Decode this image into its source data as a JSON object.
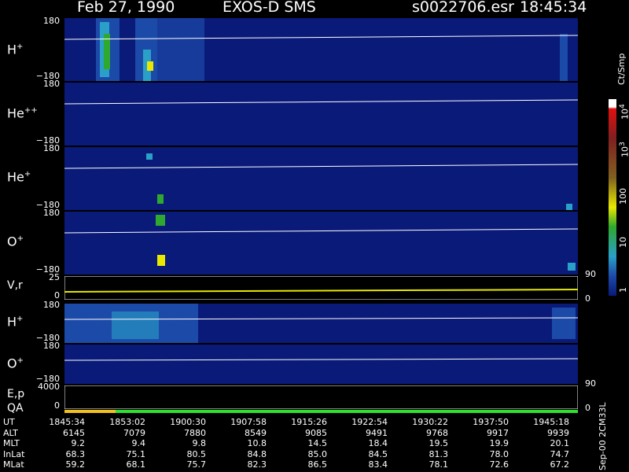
{
  "header": {
    "date": "Feb 27, 1990",
    "instrument": "EXOS-D SMS",
    "file": "s0022706.esr",
    "time": "18:45:34"
  },
  "panels": [
    {
      "label_main": "H",
      "label_sup": "+",
      "ymax": "180",
      "ymin": "−180"
    },
    {
      "label_main": "He",
      "label_sup": "++",
      "ymax": "180",
      "ymin": "−180"
    },
    {
      "label_main": "He",
      "label_sup": "+",
      "ymax": "180",
      "ymin": "−180"
    },
    {
      "label_main": "O",
      "label_sup": "+",
      "ymax": "180",
      "ymin": "−180"
    },
    {
      "label_main": "V,r",
      "label_sup": "",
      "ymax": "25",
      "ymin": "0",
      "rmax": "90",
      "rmin": "0"
    },
    {
      "label_main": "H",
      "label_sup": "+",
      "ymax": "180",
      "ymin": "−180"
    },
    {
      "label_main": "O",
      "label_sup": "+",
      "ymax": "180",
      "ymin": "−180"
    },
    {
      "label_main": "E,p",
      "label_sup": "",
      "ymax": "4000",
      "ymin": "0",
      "rmax": "90",
      "rmin": "0"
    }
  ],
  "qa_label": "QA",
  "colorbar": {
    "unit": "Ct/Smp",
    "tick_1e4_base": "10",
    "tick_1e4_exp": "4",
    "tick_1e3_base": "10",
    "tick_1e3_exp": "3",
    "tick_100": "100",
    "tick_10": "10",
    "tick_1": "1"
  },
  "footer_right": "Sep-00 2CM33L",
  "orbit_table": {
    "rows": [
      {
        "label": "UT",
        "values": [
          "1845:34",
          "1853:02",
          "1900:30",
          "1907:58",
          "1915:26",
          "1922:54",
          "1930:22",
          "1937:50",
          "1945:18"
        ]
      },
      {
        "label": "ALT",
        "values": [
          "6145",
          "7079",
          "7880",
          "8549",
          "9085",
          "9491",
          "9768",
          "9917",
          "9939"
        ]
      },
      {
        "label": "MLT",
        "values": [
          "9.2",
          "9.4",
          "9.8",
          "10.8",
          "14.5",
          "18.4",
          "19.5",
          "19.9",
          "20.1"
        ]
      },
      {
        "label": "InLat",
        "values": [
          "68.3",
          "75.1",
          "80.5",
          "84.8",
          "85.0",
          "84.5",
          "81.3",
          "78.0",
          "74.7"
        ]
      },
      {
        "label": "MLat",
        "values": [
          "59.2",
          "68.1",
          "75.7",
          "82.3",
          "86.5",
          "83.4",
          "78.1",
          "72.6",
          "67.2"
        ]
      }
    ]
  },
  "chart_data": {
    "type": "heatmap",
    "title": "Feb 27, 1990   EXOS-D SMS",
    "x_tick_labels": [
      "1845:34",
      "1853:02",
      "1900:30",
      "1907:58",
      "1915:26",
      "1922:54",
      "1930:22",
      "1937:50",
      "1945:18"
    ],
    "xlabel": "UT",
    "colorbar_unit": "Ct/Smp",
    "colorbar_range": [
      1,
      10000
    ],
    "colorbar_scale": "log",
    "colors": {
      "background": "#0a1a78",
      "low": "#1c4aa8",
      "mid": "#2aa0c8",
      "green": "#2ea82e",
      "yellow": "#e8e800",
      "red": "#e01010",
      "white": "#ffffff",
      "qa_bar_yellow": "#f0c020",
      "qa_bar_green": "#30e030"
    },
    "panel_ranges": {
      "H+": [
        -180,
        180
      ],
      "He++": [
        -180,
        180
      ],
      "He+": [
        -180,
        180
      ],
      "O+": [
        -180,
        180
      ],
      "V,r": [
        0,
        25
      ],
      "H+ (2)": [
        -180,
        180
      ],
      "O+ (2)": [
        -180,
        180
      ],
      "E,p": [
        0,
        4000
      ]
    },
    "right_axis_ranges": {
      "V,r": [
        0,
        90
      ],
      "E,p": [
        0,
        90
      ]
    }
  }
}
